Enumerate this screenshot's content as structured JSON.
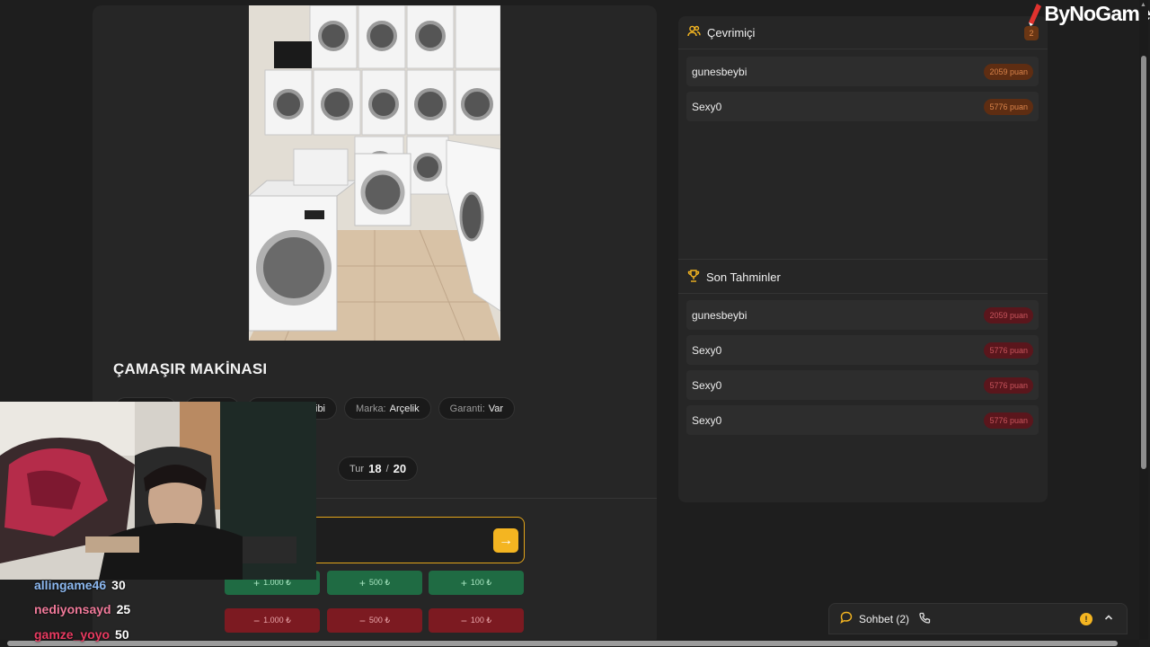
{
  "brand": {
    "logo_text": "ByNoGame"
  },
  "product": {
    "title": "ÇAMAŞIR MAKİNASI",
    "image_alt": "washing machines in store",
    "tags": [
      {
        "label": "",
        "value": ""
      },
      {
        "label": "",
        "value": ""
      },
      {
        "label": "",
        "value": "Gibi"
      },
      {
        "label": "Marka:",
        "value": "Arçelik"
      },
      {
        "label": "Garanti:",
        "value": "Var"
      }
    ]
  },
  "round": {
    "label": "Tur",
    "current": "18",
    "separator": "/",
    "total": "20"
  },
  "guess": {
    "input_value": "",
    "submit_icon": "arrow-right-icon",
    "plus_buttons": [
      "1.000 ₺",
      "500 ₺",
      "100 ₺"
    ],
    "minus_buttons": [
      "1.000 ₺",
      "500 ₺",
      "100 ₺"
    ],
    "plus_sign": "+",
    "minus_sign": "−"
  },
  "online": {
    "title": "Çevrimiçi",
    "count": "2",
    "users": [
      {
        "name": "gunesbeybi",
        "score": "2059 puan"
      },
      {
        "name": "Sexy0",
        "score": "5776 puan"
      }
    ]
  },
  "recent_guesses": {
    "title": "Son Tahminler",
    "items": [
      {
        "name": "gunesbeybi",
        "score": "2059 puan"
      },
      {
        "name": "Sexy0",
        "score": "5776 puan"
      },
      {
        "name": "Sexy0",
        "score": "5776 puan"
      },
      {
        "name": "Sexy0",
        "score": "5776 puan"
      }
    ]
  },
  "chat": {
    "label": "Sohbet (2)",
    "alert": "!"
  },
  "stream_chat": [
    {
      "user": "allingame46",
      "score": "30"
    },
    {
      "user": "nediyonsayd",
      "score": "25"
    },
    {
      "user": "gamze_yoyo",
      "score": "50"
    }
  ],
  "colors": {
    "accent": "#f4b521",
    "plus": "#1f6b43",
    "minus": "#7c1a21",
    "panel": "#262626",
    "background": "#1e1e1e"
  }
}
